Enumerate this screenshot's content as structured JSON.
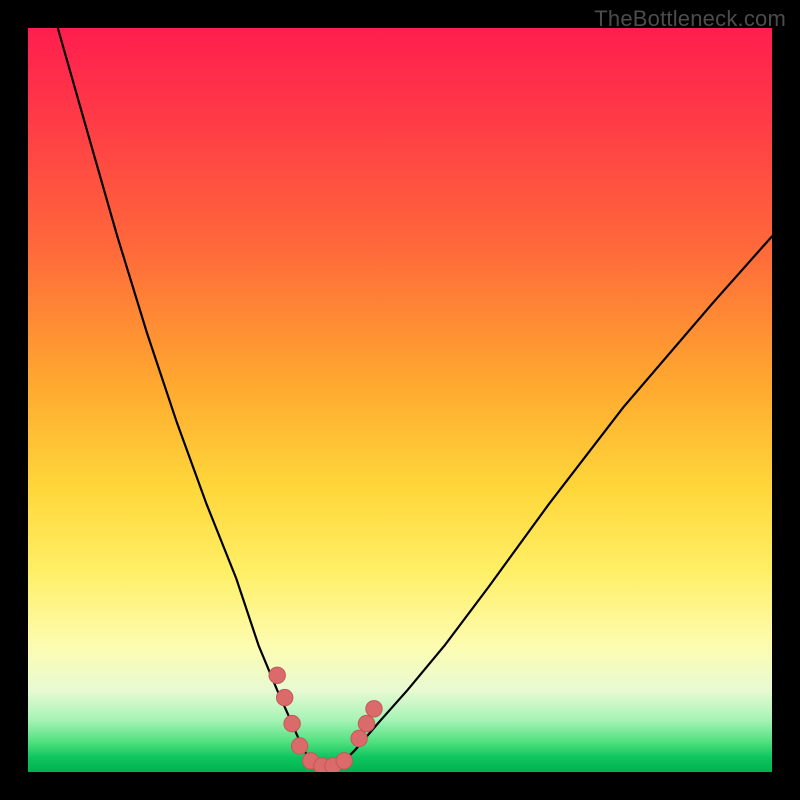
{
  "watermark": "TheBottleneck.com",
  "colors": {
    "frame": "#000000",
    "curve": "#000000",
    "marker_fill": "#db6b6b",
    "marker_stroke": "#c45858"
  },
  "chart_data": {
    "type": "line",
    "title": "",
    "xlabel": "",
    "ylabel": "",
    "xlim": [
      0,
      100
    ],
    "ylim": [
      0,
      100
    ],
    "note": "No axis ticks or numeric labels are visible; values are normalized 0-100 estimated from pixel positions.",
    "series": [
      {
        "name": "bottleneck-curve",
        "x": [
          4,
          8,
          12,
          16,
          20,
          24,
          28,
          31,
          33.5,
          35.5,
          37,
          38.5,
          40,
          42,
          44,
          47,
          51,
          56,
          62,
          70,
          80,
          92,
          100
        ],
        "y": [
          100,
          86,
          72,
          59,
          47,
          36,
          26,
          17,
          11,
          6.5,
          3,
          1,
          0.5,
          1,
          3,
          6.5,
          11,
          17,
          25,
          36,
          49,
          63,
          72
        ]
      }
    ],
    "markers": {
      "name": "highlight-dots",
      "points": [
        {
          "x": 33.5,
          "y": 13
        },
        {
          "x": 34.5,
          "y": 10
        },
        {
          "x": 35.5,
          "y": 6.5
        },
        {
          "x": 36.5,
          "y": 3.5
        },
        {
          "x": 38.0,
          "y": 1.5
        },
        {
          "x": 39.5,
          "y": 0.8
        },
        {
          "x": 41.0,
          "y": 0.8
        },
        {
          "x": 42.5,
          "y": 1.5
        },
        {
          "x": 44.5,
          "y": 4.5
        },
        {
          "x": 45.5,
          "y": 6.5
        },
        {
          "x": 46.5,
          "y": 8.5
        }
      ],
      "radius_pct": 1.1
    }
  }
}
